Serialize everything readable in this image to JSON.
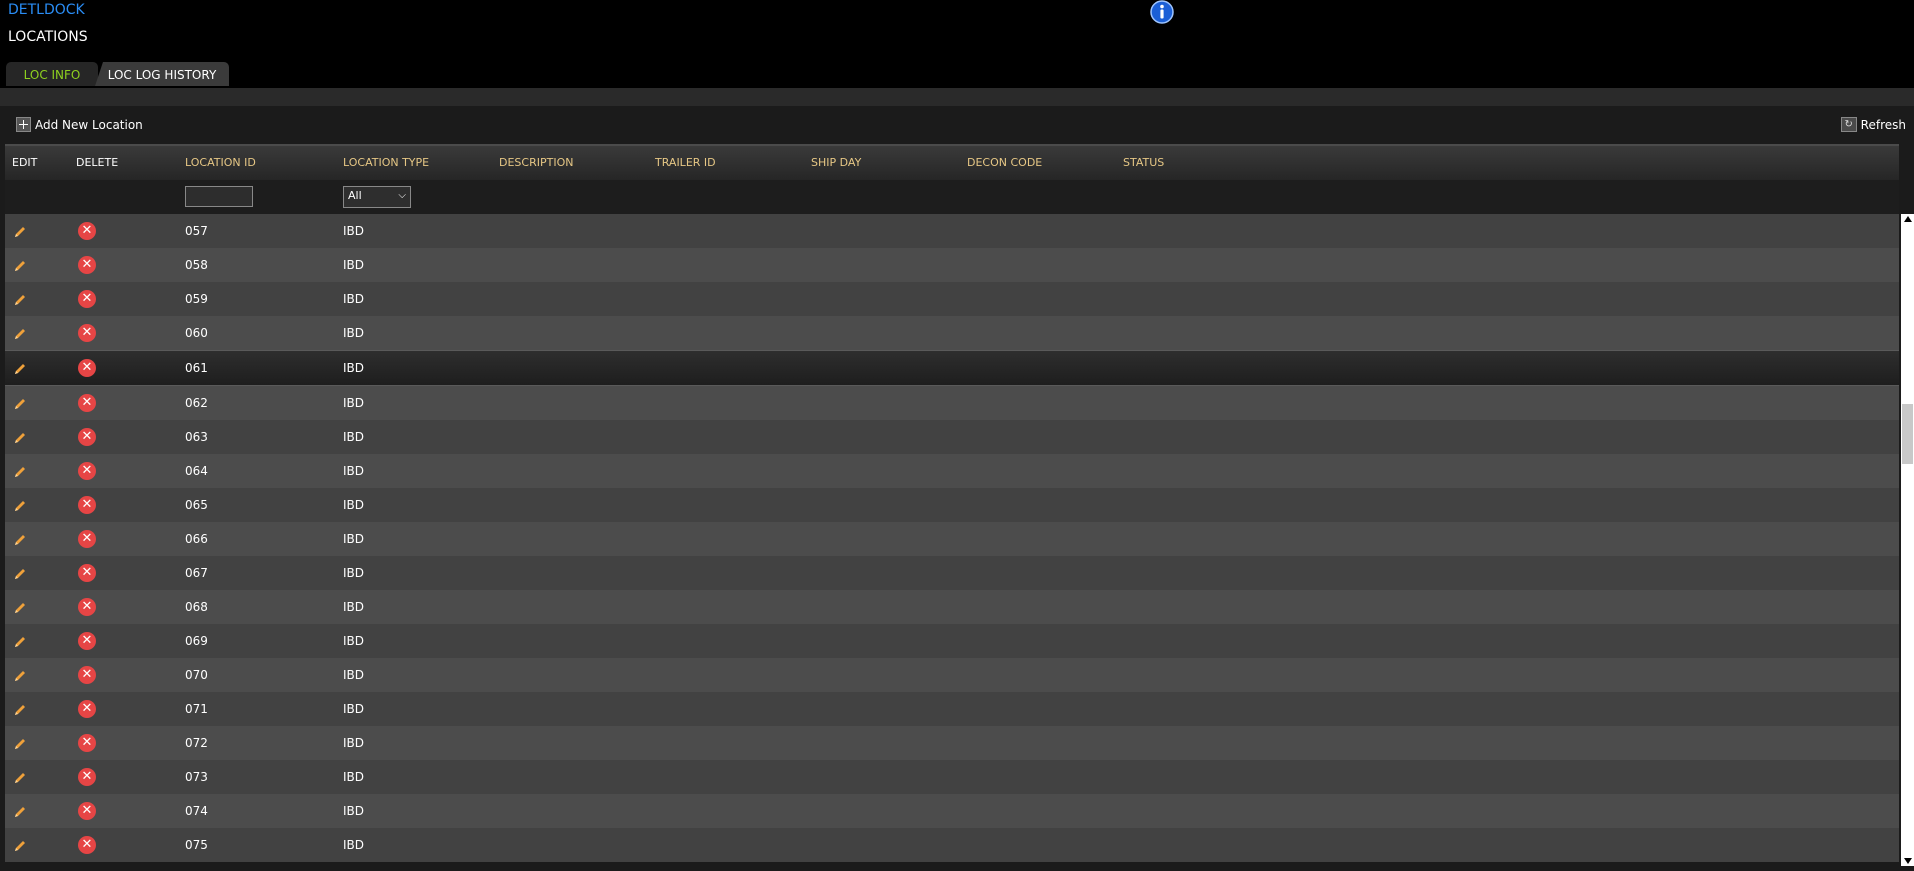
{
  "app": {
    "name": "DETLDOCK",
    "page_title": "LOCATIONS",
    "info_icon": "info-icon"
  },
  "colors": {
    "app_link": "#2a8df5",
    "active_tab": "#8ed01f",
    "header_gold": "#e6c785",
    "delete": "#e64545",
    "edit": "#f0a13a"
  },
  "tabs": [
    {
      "label": "LOC INFO",
      "active": true
    },
    {
      "label": "LOC LOG HISTORY",
      "active": false
    }
  ],
  "toolbar": {
    "add_label": "Add New Location",
    "refresh_label": "Refresh"
  },
  "grid": {
    "columns": [
      "EDIT",
      "DELETE",
      "LOCATION ID",
      "LOCATION TYPE",
      "DESCRIPTION",
      "TRAILER ID",
      "SHIP DAY",
      "DECON CODE",
      "STATUS"
    ],
    "filter": {
      "location_id_value": "",
      "location_type_selected": "All"
    },
    "rows": [
      {
        "id": "057",
        "type": "IBD"
      },
      {
        "id": "058",
        "type": "IBD"
      },
      {
        "id": "059",
        "type": "IBD"
      },
      {
        "id": "060",
        "type": "IBD"
      },
      {
        "id": "061",
        "type": "IBD",
        "selected": true
      },
      {
        "id": "062",
        "type": "IBD"
      },
      {
        "id": "063",
        "type": "IBD"
      },
      {
        "id": "064",
        "type": "IBD"
      },
      {
        "id": "065",
        "type": "IBD"
      },
      {
        "id": "066",
        "type": "IBD"
      },
      {
        "id": "067",
        "type": "IBD"
      },
      {
        "id": "068",
        "type": "IBD"
      },
      {
        "id": "069",
        "type": "IBD"
      },
      {
        "id": "070",
        "type": "IBD"
      },
      {
        "id": "071",
        "type": "IBD"
      },
      {
        "id": "072",
        "type": "IBD"
      },
      {
        "id": "073",
        "type": "IBD"
      },
      {
        "id": "074",
        "type": "IBD"
      },
      {
        "id": "075",
        "type": "IBD"
      }
    ]
  }
}
